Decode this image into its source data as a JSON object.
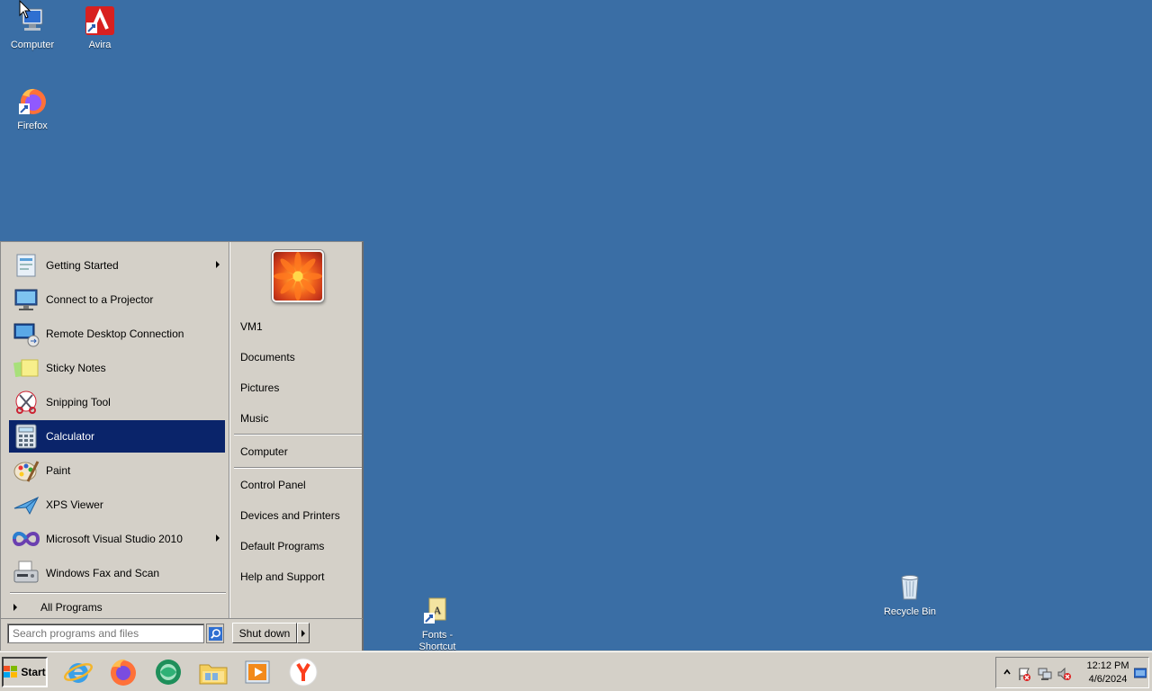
{
  "desktop": {
    "background": "#3a6ea5",
    "icons": [
      {
        "label": "Computer",
        "icon": "computer-icon"
      },
      {
        "label": "Avira",
        "icon": "avira-icon"
      },
      {
        "label": "Firefox",
        "icon": "firefox-icon"
      },
      {
        "label": "Fonts -\nShortcut",
        "icon": "folder-shortcut-icon"
      },
      {
        "label": "Recycle Bin",
        "icon": "recycle-bin-icon"
      }
    ]
  },
  "start_menu": {
    "programs": [
      {
        "label": "Getting Started",
        "icon": "getting-started-icon",
        "submenu": true
      },
      {
        "label": "Connect to a Projector",
        "icon": "projector-icon",
        "submenu": false
      },
      {
        "label": "Remote Desktop Connection",
        "icon": "remote-desktop-icon",
        "submenu": false
      },
      {
        "label": "Sticky Notes",
        "icon": "sticky-notes-icon",
        "submenu": false
      },
      {
        "label": "Snipping Tool",
        "icon": "snipping-tool-icon",
        "submenu": false
      },
      {
        "label": "Calculator",
        "icon": "calculator-icon",
        "submenu": false,
        "selected": true
      },
      {
        "label": "Paint",
        "icon": "paint-icon",
        "submenu": false
      },
      {
        "label": "XPS Viewer",
        "icon": "xps-viewer-icon",
        "submenu": false
      },
      {
        "label": "Microsoft Visual Studio 2010",
        "icon": "visual-studio-icon",
        "submenu": true
      },
      {
        "label": "Windows Fax and Scan",
        "icon": "fax-scan-icon",
        "submenu": false
      }
    ],
    "all_programs": "All Programs",
    "places": [
      {
        "label": "VM1"
      },
      {
        "label": "Documents"
      },
      {
        "label": "Pictures"
      },
      {
        "label": "Music"
      },
      {
        "label": "Computer"
      },
      {
        "label": "Control Panel"
      },
      {
        "label": "Devices and Printers"
      },
      {
        "label": "Default Programs"
      },
      {
        "label": "Help and Support"
      }
    ],
    "search_placeholder": "Search programs and files",
    "shutdown_label": "Shut down",
    "selected_color": "#0a246a"
  },
  "taskbar": {
    "start_label": "Start",
    "quick_launch": [
      {
        "icon": "internet-explorer-icon"
      },
      {
        "icon": "firefox-icon"
      },
      {
        "icon": "app-icon"
      },
      {
        "icon": "file-explorer-icon"
      },
      {
        "icon": "media-player-icon"
      },
      {
        "icon": "yandex-icon"
      }
    ],
    "tray": {
      "time": "12:12 PM",
      "date": "4/6/2024",
      "icons": [
        "show-hidden-icon",
        "action-center-icon",
        "network-icon",
        "volume-muted-icon"
      ]
    }
  }
}
